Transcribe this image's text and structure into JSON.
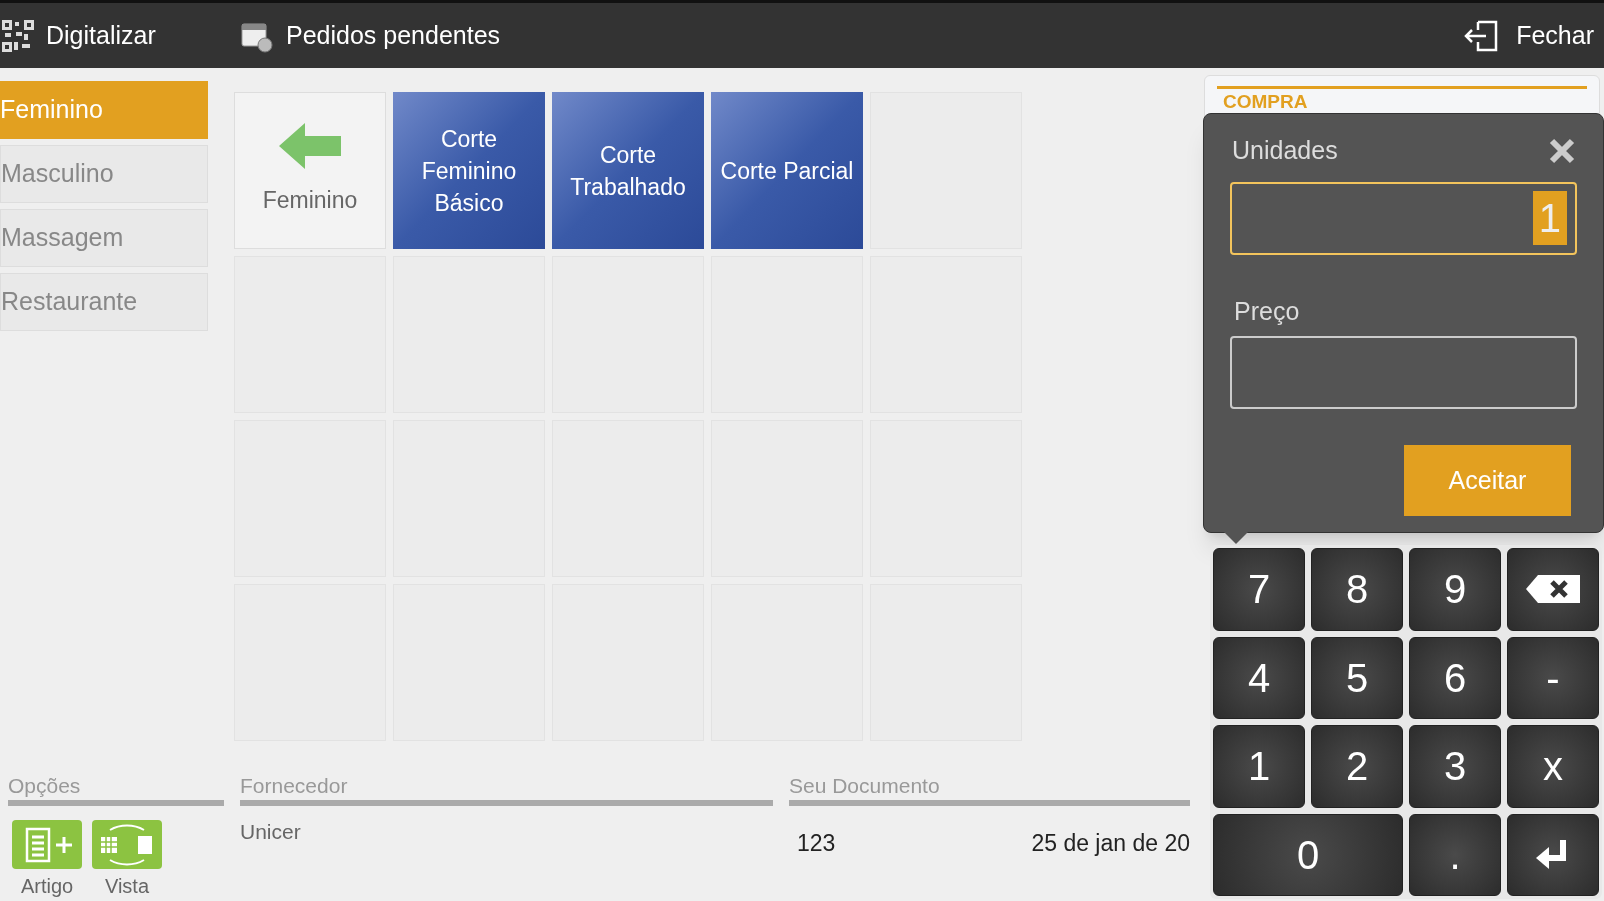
{
  "top_bar": {
    "scan": "Digitalizar",
    "pending": "Pedidos pendentes",
    "close": "Fechar"
  },
  "categories": [
    {
      "label": "Feminino",
      "selected": true
    },
    {
      "label": "Masculino",
      "selected": false
    },
    {
      "label": "Massagem",
      "selected": false
    },
    {
      "label": "Restaurante",
      "selected": false
    }
  ],
  "tiles": [
    {
      "kind": "back",
      "label": "Feminino"
    },
    {
      "kind": "product",
      "label": "Corte Feminino Básico"
    },
    {
      "kind": "product",
      "label": "Corte Trabalhado"
    },
    {
      "kind": "product",
      "label": "Corte Parcial"
    },
    {
      "kind": "empty"
    },
    {
      "kind": "empty"
    },
    {
      "kind": "empty"
    },
    {
      "kind": "empty"
    },
    {
      "kind": "empty"
    },
    {
      "kind": "empty"
    },
    {
      "kind": "empty"
    },
    {
      "kind": "empty"
    },
    {
      "kind": "empty"
    },
    {
      "kind": "empty"
    },
    {
      "kind": "empty"
    },
    {
      "kind": "empty"
    },
    {
      "kind": "empty"
    },
    {
      "kind": "empty"
    },
    {
      "kind": "empty"
    },
    {
      "kind": "empty"
    }
  ],
  "card": {
    "title": "COMPRA"
  },
  "popup": {
    "units_label": "Unidades",
    "units_value": "1",
    "price_label": "Preço",
    "accept": "Aceitar"
  },
  "keypad": [
    {
      "kind": "text",
      "label": "7"
    },
    {
      "kind": "text",
      "label": "8"
    },
    {
      "kind": "text",
      "label": "9"
    },
    {
      "kind": "backspace"
    },
    {
      "kind": "text",
      "label": "4"
    },
    {
      "kind": "text",
      "label": "5"
    },
    {
      "kind": "text",
      "label": "6"
    },
    {
      "kind": "text",
      "label": "-"
    },
    {
      "kind": "text",
      "label": "1"
    },
    {
      "kind": "text",
      "label": "2"
    },
    {
      "kind": "text",
      "label": "3"
    },
    {
      "kind": "text",
      "label": "x"
    },
    {
      "kind": "wide",
      "label": "0"
    },
    {
      "kind": "text",
      "label": "."
    },
    {
      "kind": "enter"
    }
  ],
  "options": {
    "title": "Opções",
    "buttons": [
      {
        "kind": "article",
        "label": "Artigo"
      },
      {
        "kind": "view",
        "label": "Vista"
      }
    ]
  },
  "supplier": {
    "title": "Fornecedor",
    "value": "Unicer"
  },
  "document": {
    "title": "Seu Documento",
    "number": "123",
    "date": "25 de jan de 20"
  }
}
